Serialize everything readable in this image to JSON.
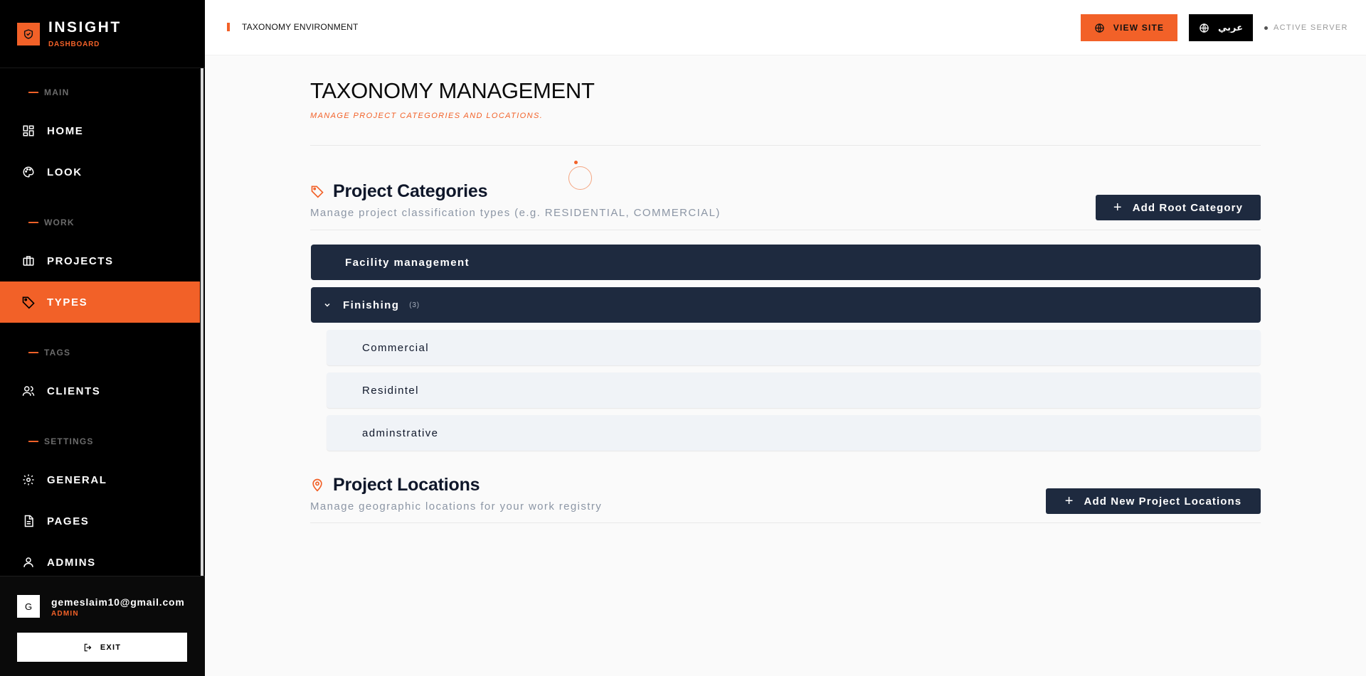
{
  "brand": {
    "title": "INSIGHT",
    "subtitle": "DASHBOARD"
  },
  "sidebar": {
    "sections": [
      "MAIN",
      "WORK",
      "TAGS",
      "SETTINGS"
    ],
    "items": [
      {
        "label": "HOME",
        "icon": "dashboard-icon"
      },
      {
        "label": "LOOK",
        "icon": "palette-icon"
      },
      {
        "label": "PROJECTS",
        "icon": "briefcase-icon"
      },
      {
        "label": "TYPES",
        "icon": "tag-icon",
        "active": true
      },
      {
        "label": "CLIENTS",
        "icon": "users-icon"
      },
      {
        "label": "GENERAL",
        "icon": "gear-icon"
      },
      {
        "label": "PAGES",
        "icon": "file-icon"
      },
      {
        "label": "ADMINS",
        "icon": "user-icon"
      }
    ]
  },
  "user": {
    "initial": "G",
    "email": "gemeslaim10@gmail.com",
    "role": "ADMIN",
    "exit_label": "EXIT"
  },
  "topbar": {
    "env_label": "TAXONOMY ENVIRONMENT",
    "view_site": "VIEW SITE",
    "lang": "عربي",
    "server": "ACTIVE SERVER"
  },
  "page": {
    "title": "TAXONOMY MANAGEMENT",
    "subtitle": "MANAGE PROJECT CATEGORIES AND LOCATIONS."
  },
  "categories": {
    "title": "Project Categories",
    "subtitle": "Manage project classification types (e.g. RESIDENTIAL, COMMERCIAL)",
    "add_label": "Add Root Category",
    "rows": [
      {
        "name": "Facility management"
      },
      {
        "name": "Finishing",
        "count": "(3)",
        "expanded": true,
        "children": [
          "Commercial",
          "Residintel",
          "adminstrative"
        ]
      }
    ]
  },
  "locations": {
    "title": "Project Locations",
    "subtitle": "Manage geographic locations for your work registry",
    "add_label": "Add New Project Locations"
  },
  "colors": {
    "accent": "#f26128",
    "dark": "#1e2a3f",
    "sidebar": "#000000"
  }
}
